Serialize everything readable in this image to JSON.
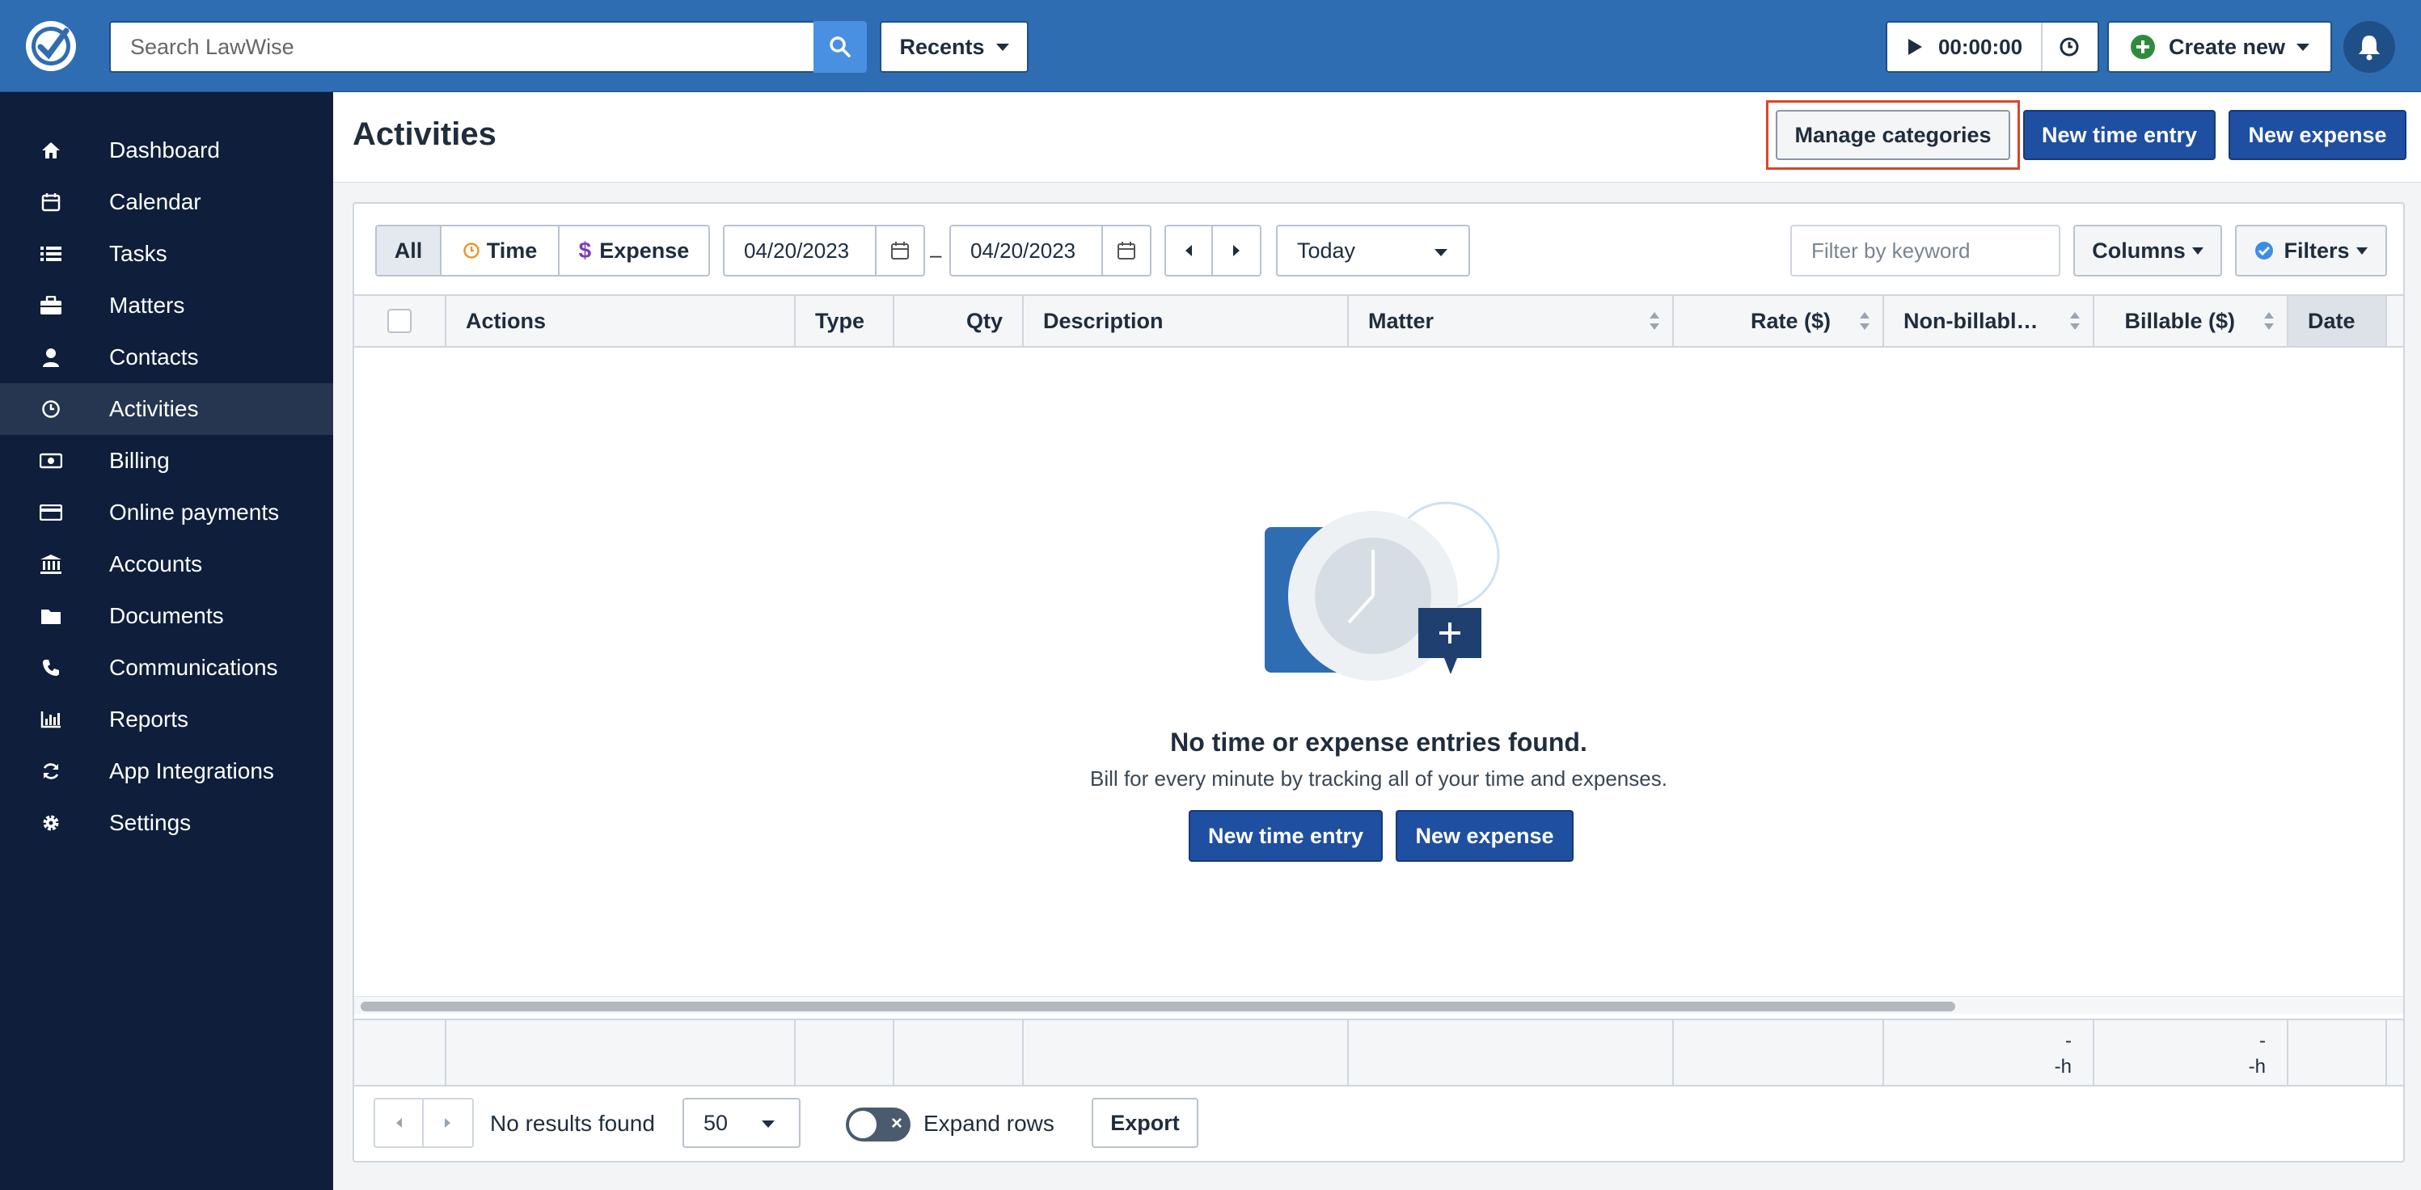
{
  "app": {
    "search_placeholder": "Search LawWise",
    "recents_label": "Recents",
    "timer_value": "00:00:00",
    "create_new_label": "Create new"
  },
  "sidebar": {
    "items": [
      {
        "label": "Dashboard",
        "icon": "home-icon"
      },
      {
        "label": "Calendar",
        "icon": "calendar-icon"
      },
      {
        "label": "Tasks",
        "icon": "list-icon"
      },
      {
        "label": "Matters",
        "icon": "briefcase-icon"
      },
      {
        "label": "Contacts",
        "icon": "person-icon"
      },
      {
        "label": "Activities",
        "icon": "clock-icon",
        "active": true
      },
      {
        "label": "Billing",
        "icon": "money-icon"
      },
      {
        "label": "Online payments",
        "icon": "credit-card-icon"
      },
      {
        "label": "Accounts",
        "icon": "bank-icon"
      },
      {
        "label": "Documents",
        "icon": "folder-icon"
      },
      {
        "label": "Communications",
        "icon": "phone-icon"
      },
      {
        "label": "Reports",
        "icon": "bar-chart-icon"
      },
      {
        "label": "App Integrations",
        "icon": "sync-icon"
      },
      {
        "label": "Settings",
        "icon": "gear-icon"
      }
    ]
  },
  "header": {
    "title": "Activities",
    "manage_categories": "Manage categories",
    "new_time_entry": "New time entry",
    "new_expense": "New expense"
  },
  "toolbar": {
    "segments": [
      "All",
      "Time",
      "Expense"
    ],
    "active_segment": "All",
    "date_from": "04/20/2023",
    "date_to": "04/20/2023",
    "date_separator": "–",
    "range_preset": "Today",
    "filter_placeholder": "Filter by keyword",
    "columns_label": "Columns",
    "filters_label": "Filters"
  },
  "table": {
    "columns": [
      "Actions",
      "Type",
      "Qty",
      "Description",
      "Matter",
      "Rate ($)",
      "Non-billabl…",
      "Billable ($)",
      "Date"
    ],
    "footer": {
      "non_billable_amount": "-",
      "non_billable_hours": "-h",
      "billable_amount": "-",
      "billable_hours": "-h"
    }
  },
  "empty_state": {
    "title": "No time or expense entries found.",
    "subtitle": "Bill for every minute by tracking all of your time and expenses.",
    "new_time_entry": "New time entry",
    "new_expense": "New expense"
  },
  "footer": {
    "no_results": "No results found",
    "per_page": "50",
    "expand_rows": "Expand rows",
    "export": "Export"
  },
  "colors": {
    "topbar": "#2f6db3",
    "sidebar": "#0e1e3b",
    "primary_button": "#1f4fa0",
    "highlight": "#d9462b"
  }
}
